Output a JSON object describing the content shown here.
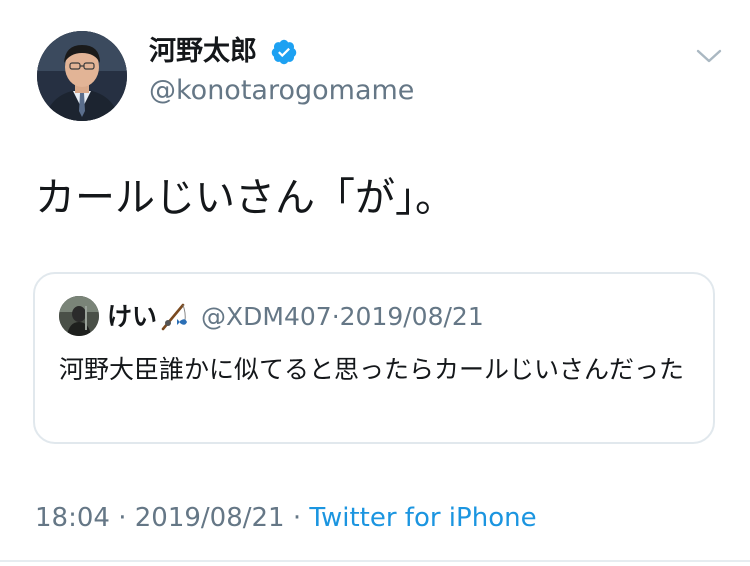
{
  "author": {
    "display_name": "河野太郎",
    "handle": "@konotarogomame",
    "verified": true
  },
  "icons": {
    "verified": "verified-badge-icon",
    "menu": "chevron-down-icon",
    "quote_emoji": "fishing-pole-icon"
  },
  "tweet": {
    "text": "カールじいさん「が」。"
  },
  "quoted_tweet": {
    "display_name": "けい",
    "handle": "@XDM407",
    "separator": "·",
    "date": "2019/08/21",
    "text": "河野大臣誰かに似てると思ったらカールじいさんだった"
  },
  "meta": {
    "time": "18:04",
    "sep1": "·",
    "date": "2019/08/21",
    "sep2": "·",
    "source": "Twitter for iPhone"
  },
  "colors": {
    "accent": "#1b95e0",
    "verified": "#1da1f2",
    "secondary_text": "#657786",
    "border": "#e1e8ed"
  }
}
